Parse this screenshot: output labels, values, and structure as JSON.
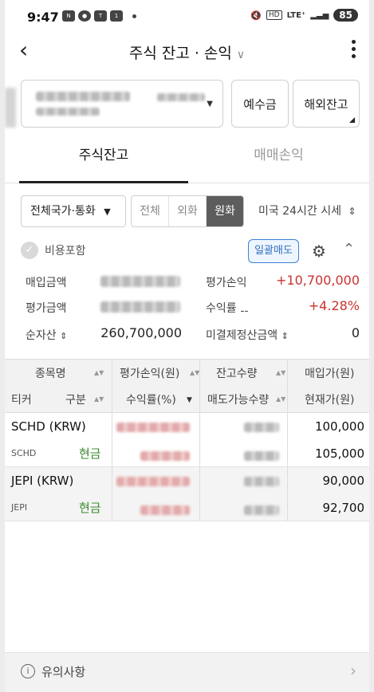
{
  "status": {
    "time": "9:47",
    "battery": "85",
    "network": "LTE⁺",
    "icons": [
      "n-icon",
      "chat-icon",
      "talk-icon",
      "one-icon",
      "dot-icon",
      "mute-icon",
      "hd-icon",
      "signal-icon"
    ]
  },
  "header": {
    "title": "주식 잔고 · 손익"
  },
  "account": {
    "deposit_btn": "예수금",
    "overseas_btn": "해외잔고"
  },
  "tabs": {
    "holdings": "주식잔고",
    "pnl": "매매손익"
  },
  "filters": {
    "country": "전체국가·통화",
    "seg_all": "전체",
    "seg_fx": "외화",
    "seg_krw": "원화",
    "live": "미국 24시간 시세"
  },
  "options": {
    "include_fee": "비용포함",
    "bulk_sell": "일괄매도"
  },
  "summary": {
    "buy_amount_label": "매입금액",
    "eval_amount_label": "평가금액",
    "net_asset_label": "순자산",
    "net_asset_value": "260,700,000",
    "eval_pnl_label": "평가손익",
    "eval_pnl_value": "+10,700,000",
    "return_label": "수익률",
    "return_value": "+4.28%",
    "unsettled_label": "미결제정산금액",
    "unsettled_value": "0"
  },
  "table": {
    "h_name": "종목명",
    "h_ticker": "티커",
    "h_type": "구분",
    "h_pnl": "평가손익(원)",
    "h_rate": "수익률(%)",
    "h_qty": "잔고수량",
    "h_sellable": "매도가능수량",
    "h_buy": "매입가(원)",
    "h_price": "현재가(원)",
    "rows": [
      {
        "name": "SCHD (KRW)",
        "ticker": "SCHD",
        "type": "현금",
        "buy_price": "100,000",
        "current_price": "105,000"
      },
      {
        "name": "JEPI (KRW)",
        "ticker": "JEPI",
        "type": "현금",
        "buy_price": "90,000",
        "current_price": "92,700"
      }
    ]
  },
  "footer": {
    "label": "유의사항"
  },
  "colors": {
    "red": "#c8332f",
    "green": "#3a8a2d",
    "blue": "#2f6fbf"
  }
}
